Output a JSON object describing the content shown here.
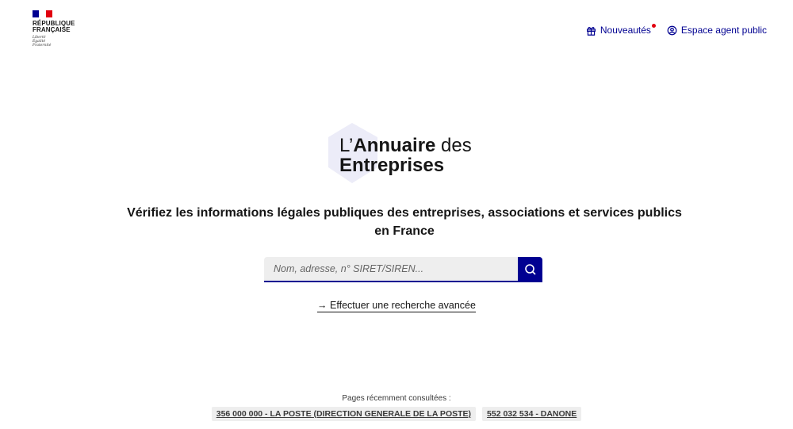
{
  "header": {
    "logo_line1": "RÉPUBLIQUE",
    "logo_line2": "FRANÇAISE",
    "motto": [
      "Liberté",
      "Égalité",
      "Fraternité"
    ],
    "nav": [
      {
        "label": "Nouveautés",
        "icon": "gift-icon"
      },
      {
        "label": "Espace agent public",
        "icon": "user-circle-icon"
      }
    ]
  },
  "brand": {
    "prefix": "L’",
    "bold": "Annuaire",
    "suffix": " des",
    "line2": "Entreprises"
  },
  "headline": "Vérifiez les informations légales publiques des entreprises, associations et services publics en France",
  "search": {
    "placeholder": "Nom, adresse, n° SIRET/SIREN...",
    "value": ""
  },
  "advanced_link": "→ Effectuer une recherche avancée",
  "recent": {
    "label": "Pages récemment consultées :",
    "items": [
      "356 000 000 - LA POSTE (DIRECTION GENERALE DE LA POSTE)",
      "552 032 534 - DANONE"
    ]
  },
  "colors": {
    "accent": "#000091",
    "marianne_red": "#e1000f",
    "hex_bg": "#ececf8"
  }
}
